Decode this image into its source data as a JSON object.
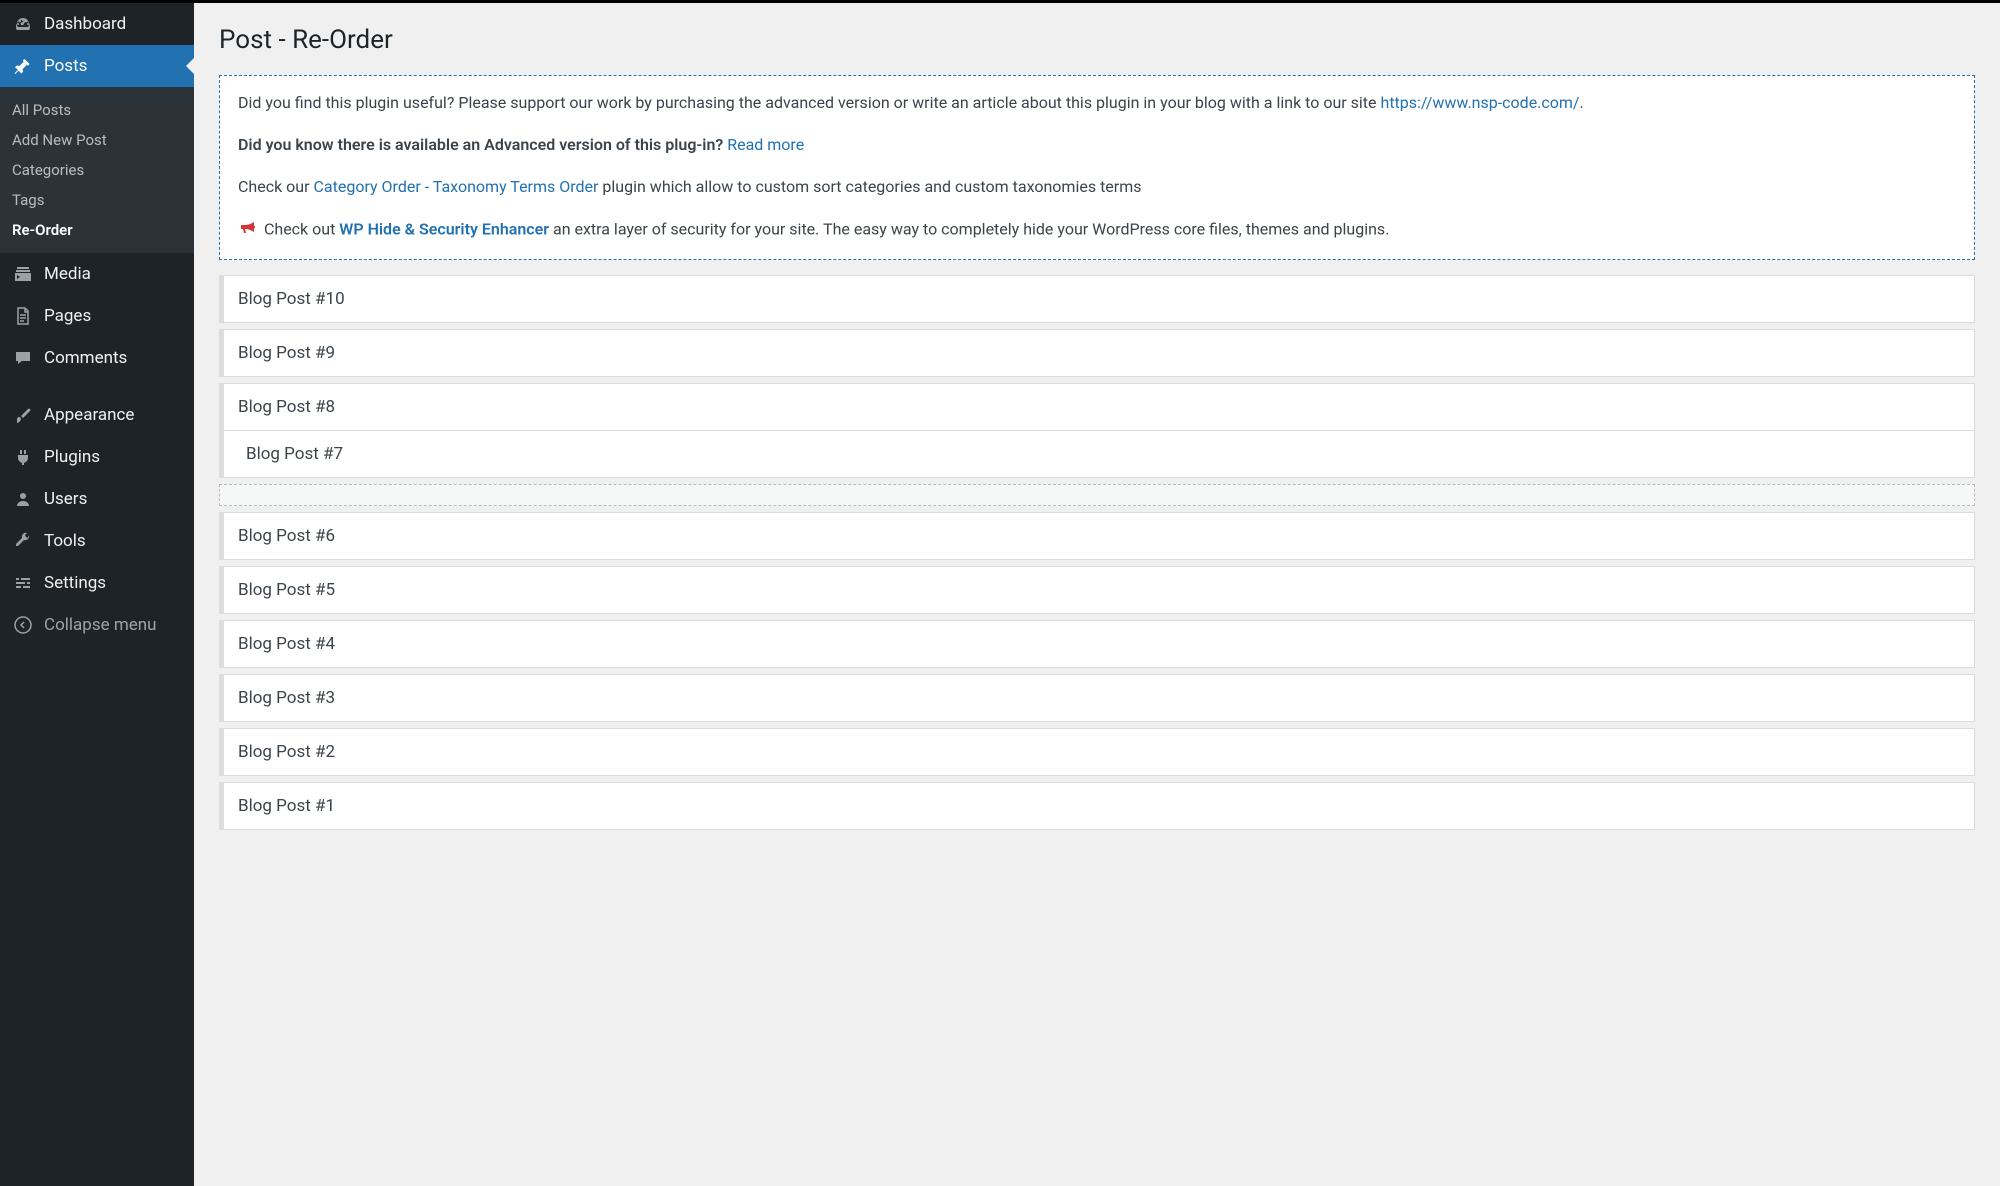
{
  "sidebar": {
    "dashboard": "Dashboard",
    "posts": "Posts",
    "posts_sub": {
      "all_posts": "All Posts",
      "add_new": "Add New Post",
      "categories": "Categories",
      "tags": "Tags",
      "reorder": "Re-Order"
    },
    "media": "Media",
    "pages": "Pages",
    "comments": "Comments",
    "appearance": "Appearance",
    "plugins": "Plugins",
    "users": "Users",
    "tools": "Tools",
    "settings": "Settings",
    "collapse": "Collapse menu"
  },
  "page": {
    "title": "Post - Re-Order"
  },
  "info": {
    "p1_a": "Did you find this plugin useful? Please support our work by purchasing the advanced version or write an article about this plugin in your blog with a link to our site ",
    "p1_link": "https://www.nsp-code.com/",
    "p1_b": ".",
    "p2_strong": "Did you know there is available an Advanced version of this plug-in?",
    "p2_link": "Read more",
    "p3_a": "Check our ",
    "p3_link": "Category Order - Taxonomy Terms Order",
    "p3_b": " plugin which allow to custom sort categories and custom taxonomies terms",
    "p4_a": "Check out ",
    "p4_link": "WP Hide & Security Enhancer",
    "p4_b": " an extra layer of security for your site. The easy way to completely hide your WordPress core files, themes and plugins."
  },
  "posts": [
    "Blog Post #10",
    "Blog Post #9",
    "Blog Post #8",
    "Blog Post #7",
    "Blog Post #6",
    "Blog Post #5",
    "Blog Post #4",
    "Blog Post #3",
    "Blog Post #2",
    "Blog Post #1"
  ]
}
